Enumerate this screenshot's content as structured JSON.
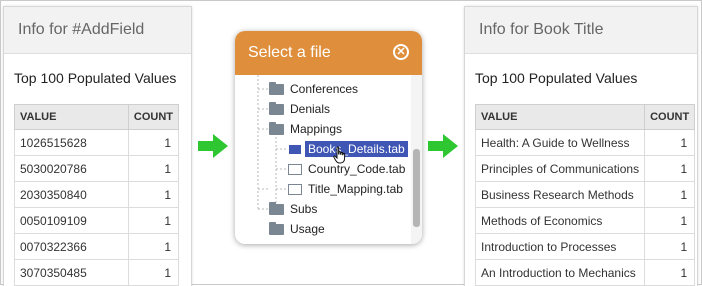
{
  "left_panel": {
    "title": "Info for #AddField",
    "subtitle": "Top 100 Populated Values",
    "columns": [
      "VALUE",
      "COUNT"
    ],
    "rows": [
      {
        "value": "1026515628",
        "count": "1"
      },
      {
        "value": "5030020786",
        "count": "1"
      },
      {
        "value": "2030350840",
        "count": "1"
      },
      {
        "value": "0050109109",
        "count": "1"
      },
      {
        "value": "0070322366",
        "count": "1"
      },
      {
        "value": "3070350485",
        "count": "1"
      }
    ]
  },
  "dialog": {
    "title": "Select a file",
    "close_icon": "close-circle-icon",
    "tree": [
      {
        "label": "Conferences",
        "type": "folder"
      },
      {
        "label": "Denials",
        "type": "folder"
      },
      {
        "label": "Mappings",
        "type": "folder"
      },
      {
        "label": "Books_Details.tab",
        "type": "file",
        "selected": true
      },
      {
        "label": "Country_Code.tab",
        "type": "file"
      },
      {
        "label": "Title_Mapping.tab",
        "type": "file"
      },
      {
        "label": "Subs",
        "type": "folder"
      },
      {
        "label": "Usage",
        "type": "folder"
      }
    ]
  },
  "right_panel": {
    "title": "Info for Book Title",
    "subtitle": "Top 100 Populated Values",
    "columns": [
      "VALUE",
      "COUNT"
    ],
    "rows": [
      {
        "value": "Health: A Guide to Wellness",
        "count": "1"
      },
      {
        "value": "Principles of Communications",
        "count": "1"
      },
      {
        "value": "Business Research Methods",
        "count": "1"
      },
      {
        "value": "Methods of Economics",
        "count": "1"
      },
      {
        "value": "Introduction to Processes",
        "count": "1"
      },
      {
        "value": "An Introduction to Mechanics",
        "count": "1"
      }
    ]
  },
  "colors": {
    "dialog_header": "#df8f3c",
    "selection": "#3f56b5",
    "arrow": "#2ec731",
    "folder": "#7a8691"
  },
  "icons": {
    "arrow": "arrow-right-icon",
    "folder": "folder-icon",
    "file": "file-icon",
    "cursor": "hand-pointer-icon"
  }
}
